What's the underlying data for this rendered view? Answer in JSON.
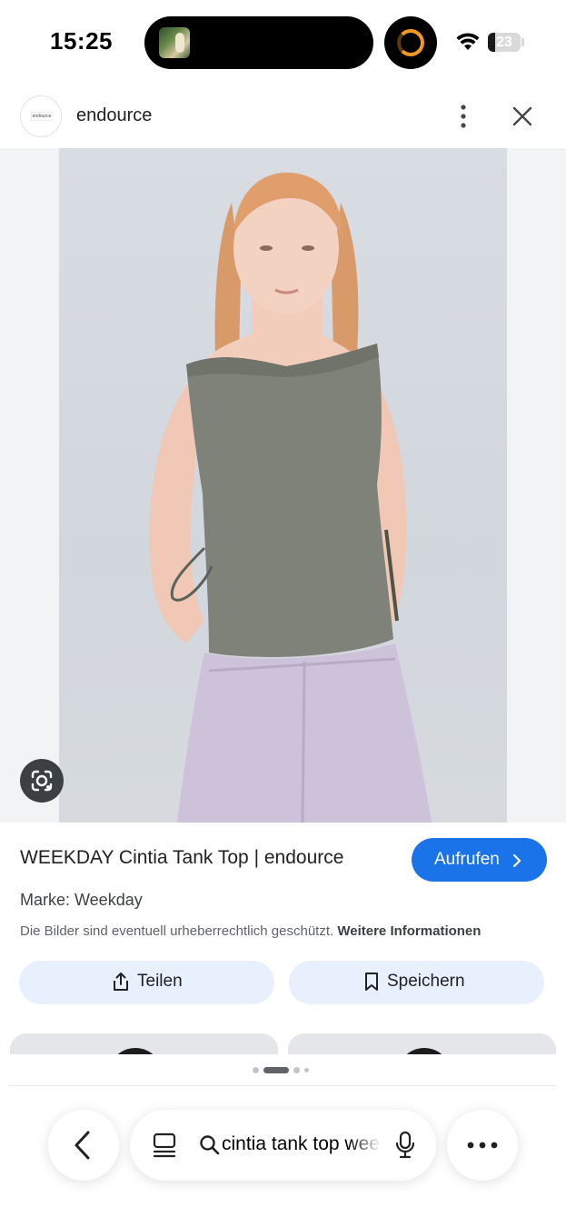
{
  "status_bar": {
    "time": "15:25",
    "battery_level": "23",
    "battery_fraction": 0.23
  },
  "header": {
    "site_name": "endource",
    "logo_text": "endource"
  },
  "product": {
    "title": "WEEKDAY Cintia Tank Top | endource",
    "visit_label": "Aufrufen",
    "brand": "Marke: Weekday",
    "copyright_notice": "Die Bilder sind eventuell urheberrechtlich geschützt.",
    "more_info_link": "Weitere Informationen",
    "share_label": "Teilen",
    "save_label": "Speichern"
  },
  "address_bar": {
    "query": "cintia tank top weekday"
  },
  "colors": {
    "accent": "#1a73e8",
    "action_button_bg": "#e8effd",
    "top_grey": "#7e8278",
    "jeans_lilac": "#cdc2d9"
  },
  "icons": {
    "header_more": "more-vertical-icon",
    "header_close": "close-icon",
    "lens": "lens-icon",
    "share": "share-icon",
    "save": "bookmark-icon",
    "back": "chevron-left-icon",
    "tabs": "tabs-icon",
    "search": "search-icon",
    "mic": "mic-icon",
    "menu": "more-horizontal-icon"
  }
}
